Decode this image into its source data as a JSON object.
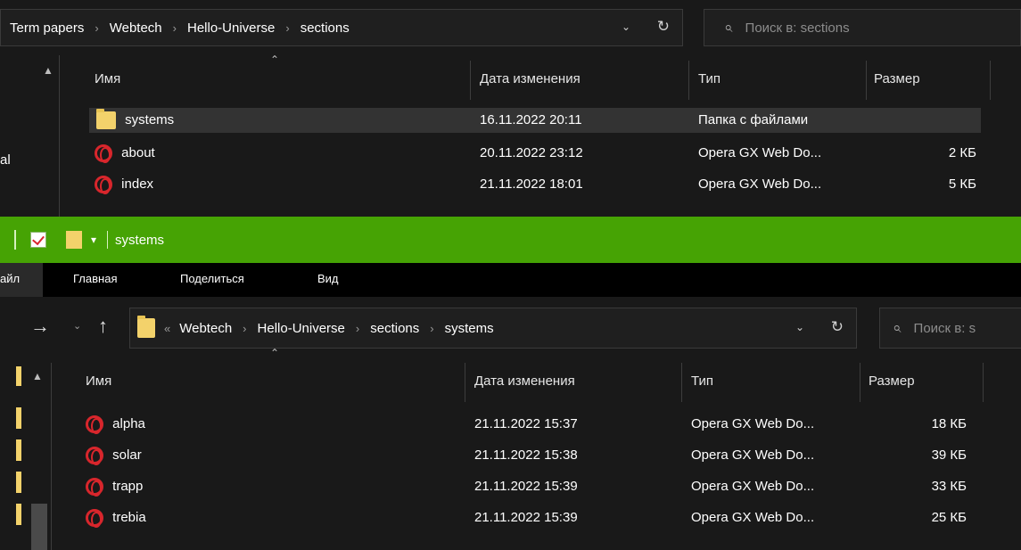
{
  "top_window": {
    "breadcrumb": [
      "Term papers",
      "Webtech",
      "Hello-Universe",
      "sections"
    ],
    "search_placeholder": "Поиск в: sections",
    "nav_left_cut": "al",
    "columns": {
      "name": "Имя",
      "date": "Дата изменения",
      "type": "Тип",
      "size": "Размер"
    },
    "rows": [
      {
        "name": "systems",
        "date": "16.11.2022 20:11",
        "type": "Папка с файлами",
        "size": "",
        "icon": "folder-icon",
        "selected": true
      },
      {
        "name": "about",
        "date": "20.11.2022 23:12",
        "type": "Opera GX Web Do...",
        "size": "2 КБ",
        "icon": "opera-icon",
        "selected": false
      },
      {
        "name": "index",
        "date": "21.11.2022 18:01",
        "type": "Opera GX Web Do...",
        "size": "5 КБ",
        "icon": "opera-icon",
        "selected": false
      }
    ]
  },
  "bottom_window": {
    "title": "systems",
    "title_bar_color": "#46a304",
    "ribbon": {
      "file_cut": "айл",
      "home": "Главная",
      "share": "Поделиться",
      "view": "Вид"
    },
    "breadcrumb_overflow": "«",
    "breadcrumb": [
      "Webtech",
      "Hello-Universe",
      "sections",
      "systems"
    ],
    "search_placeholder": "Поиск в: s",
    "columns": {
      "name": "Имя",
      "date": "Дата изменения",
      "type": "Тип",
      "size": "Размер"
    },
    "rows": [
      {
        "name": "alpha",
        "date": "21.11.2022 15:37",
        "type": "Opera GX Web Do...",
        "size": "18 КБ"
      },
      {
        "name": "solar",
        "date": "21.11.2022 15:38",
        "type": "Opera GX Web Do...",
        "size": "39 КБ"
      },
      {
        "name": "trapp",
        "date": "21.11.2022 15:39",
        "type": "Opera GX Web Do...",
        "size": "33 КБ"
      },
      {
        "name": "trebia",
        "date": "21.11.2022 15:39",
        "type": "Opera GX Web Do...",
        "size": "25 КБ"
      }
    ]
  },
  "colors": {
    "folder": "#f3d26b",
    "opera": "#d8262c",
    "background": "#191919",
    "selection": "#333333"
  }
}
